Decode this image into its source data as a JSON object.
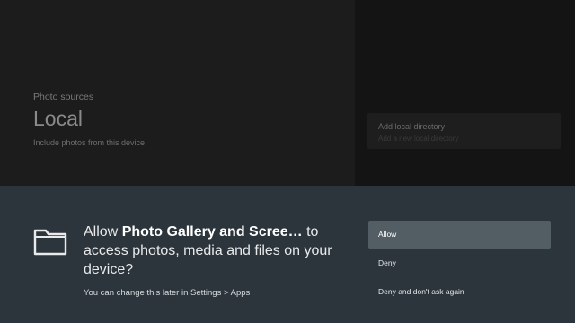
{
  "background": {
    "section_label": "Photo sources",
    "section_title": "Local",
    "section_description": "Include photos from this device",
    "directory_card": {
      "title": "Add local directory",
      "subtitle": "Add a new local directory"
    }
  },
  "dialog": {
    "icon": "folder-icon",
    "prompt_prefix": "Allow ",
    "app_name": "Photo Gallery and Scree…",
    "prompt_suffix": " to access photos, media and files on your device?",
    "hint": "You can change this later in Settings > Apps",
    "actions": [
      {
        "label": "Allow",
        "focused": true
      },
      {
        "label": "Deny",
        "focused": false
      },
      {
        "label": "Deny and don't ask again",
        "focused": false
      }
    ]
  },
  "colors": {
    "dialog_background": "#2d353c",
    "focused_action": "#535d64"
  }
}
